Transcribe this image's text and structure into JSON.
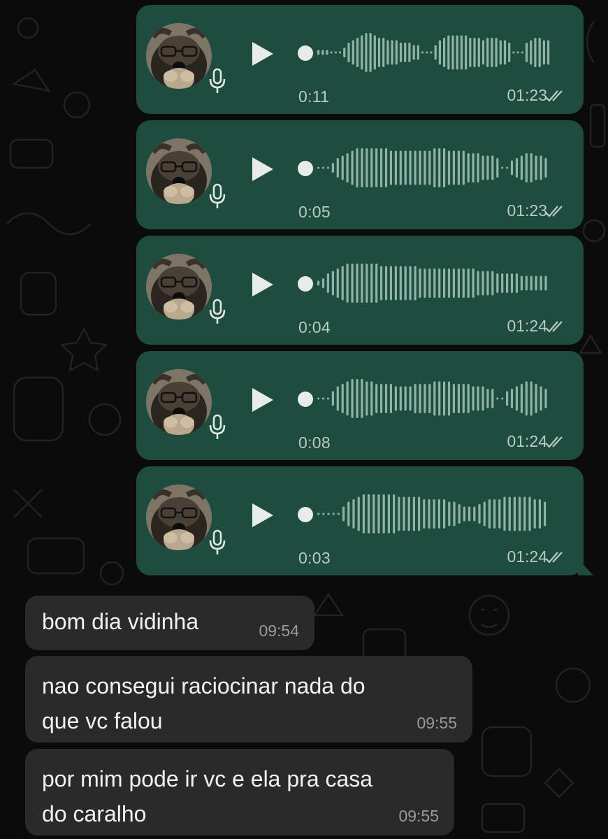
{
  "colors": {
    "background": "#0b0b0b",
    "outgoing_bubble": "#1e4c3f",
    "incoming_bubble": "#2a2a2b",
    "waveform_played": "#e7ebea",
    "waveform_unplayed": "#8fb3a7",
    "meta_text": "#b8cbc4"
  },
  "icons": {
    "play": "play-icon",
    "mic": "microphone-icon",
    "read_receipt": "double-check-icon",
    "avatar": "dog-with-glasses-avatar"
  },
  "voice_messages": [
    {
      "duration": "0:11",
      "time": "01:23"
    },
    {
      "duration": "0:05",
      "time": "01:23"
    },
    {
      "duration": "0:04",
      "time": "01:24"
    },
    {
      "duration": "0:08",
      "time": "01:24"
    },
    {
      "duration": "0:03",
      "time": "01:24"
    }
  ],
  "incoming_messages": [
    {
      "lines": [
        "bom dia vidinha"
      ],
      "time": "09:54"
    },
    {
      "lines": [
        "nao consegui raciocinar nada do",
        "que vc falou"
      ],
      "time": "09:55"
    },
    {
      "lines": [
        "por mim pode ir vc e ela pra casa",
        "do caralho"
      ],
      "time": "09:55"
    }
  ]
}
